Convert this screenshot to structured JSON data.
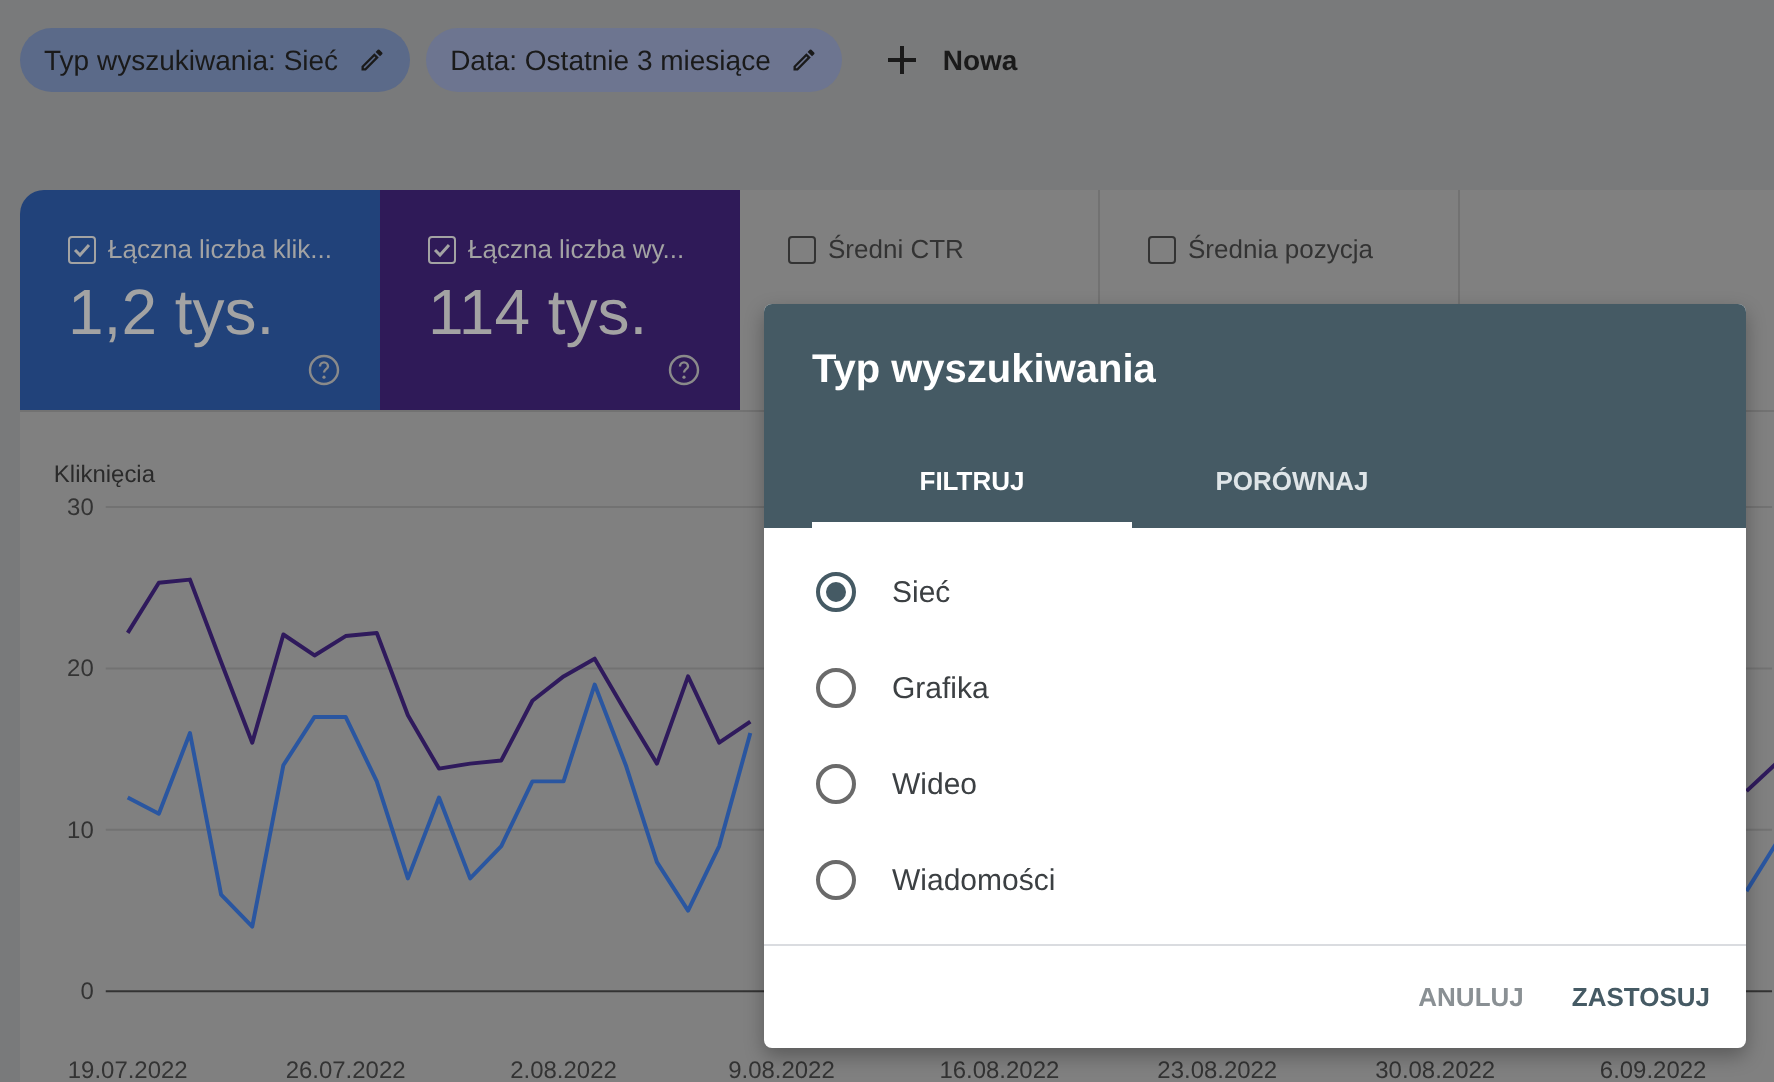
{
  "filters": [
    {
      "label": "Typ wyszukiwania: Sieć",
      "kind": "type"
    },
    {
      "label": "Data: Ostatnie 3 miesiące",
      "kind": "date"
    }
  ],
  "new_filter": {
    "label": "Nowa"
  },
  "metrics": [
    {
      "label": "Łączna liczba klik...",
      "value": "1,2 tys.",
      "checked": true,
      "color": "#21427a"
    },
    {
      "label": "Łączna liczba wy...",
      "value": "114 tys.",
      "checked": true,
      "color": "#2f1a58"
    },
    {
      "label": "Średni CTR",
      "checked": false
    },
    {
      "label": "Średnia pozycja",
      "checked": false
    }
  ],
  "chart": {
    "chart_data": {
      "type": "line",
      "ylabel": "Kliknięcia",
      "categories": [
        "19.07.2022",
        null,
        null,
        null,
        null,
        null,
        null,
        "26.07.2022",
        null,
        null,
        null,
        null,
        null,
        null,
        "2.08.2022",
        null,
        null,
        null,
        null,
        null,
        null,
        "9.08.2022",
        null,
        null,
        null,
        null,
        null,
        null,
        "16.08.2022",
        null,
        null,
        null,
        null,
        null,
        null,
        "23.08.2022",
        null,
        null,
        null,
        null,
        null,
        null,
        "30.08.2022",
        null,
        null,
        null,
        null,
        null,
        null,
        "6.09.2022",
        null,
        null,
        null,
        null
      ],
      "series": [
        {
          "color": "#2a56a0",
          "values": [
            12,
            11,
            16,
            6,
            4,
            14,
            17,
            17,
            13,
            7,
            12,
            7,
            9,
            13,
            13,
            19,
            14,
            8,
            5,
            9,
            16,
            null,
            null,
            null,
            null,
            null,
            null,
            null,
            null,
            null,
            null,
            null,
            null,
            null,
            null,
            null,
            null,
            null,
            null,
            null,
            null,
            null,
            null,
            null,
            null,
            null,
            null,
            null,
            null,
            null,
            null,
            null,
            6.2,
            9.3
          ]
        },
        {
          "color": "#2f1a5c",
          "values": [
            22.2,
            25.3,
            25.5,
            20.4,
            15.4,
            22.1,
            20.8,
            22,
            22.2,
            17.1,
            13.8,
            14.1,
            14.3,
            18,
            19.5,
            20.6,
            17.3,
            14.1,
            19.5,
            15.4,
            16.7,
            null,
            null,
            null,
            null,
            null,
            null,
            null,
            null,
            null,
            null,
            null,
            null,
            null,
            null,
            null,
            null,
            null,
            null,
            null,
            null,
            null,
            null,
            null,
            null,
            null,
            null,
            null,
            null,
            null,
            null,
            null,
            12.4,
            14.2
          ]
        }
      ],
      "ylim": [
        0,
        30
      ],
      "yticks": [
        0,
        10,
        20,
        30
      ]
    }
  },
  "dialog": {
    "title": "Typ wyszukiwania",
    "tabs": [
      {
        "label": "FILTRUJ",
        "selected": true
      },
      {
        "label": "PORÓWNAJ",
        "selected": false
      }
    ],
    "options": [
      {
        "label": "Sieć",
        "selected": true
      },
      {
        "label": "Grafika",
        "selected": false
      },
      {
        "label": "Wideo",
        "selected": false
      },
      {
        "label": "Wiadomości",
        "selected": false
      }
    ],
    "buttons": [
      {
        "label": "ANULUJ",
        "kind": "secondary"
      },
      {
        "label": "ZASTOSUJ",
        "kind": "primary"
      }
    ]
  }
}
